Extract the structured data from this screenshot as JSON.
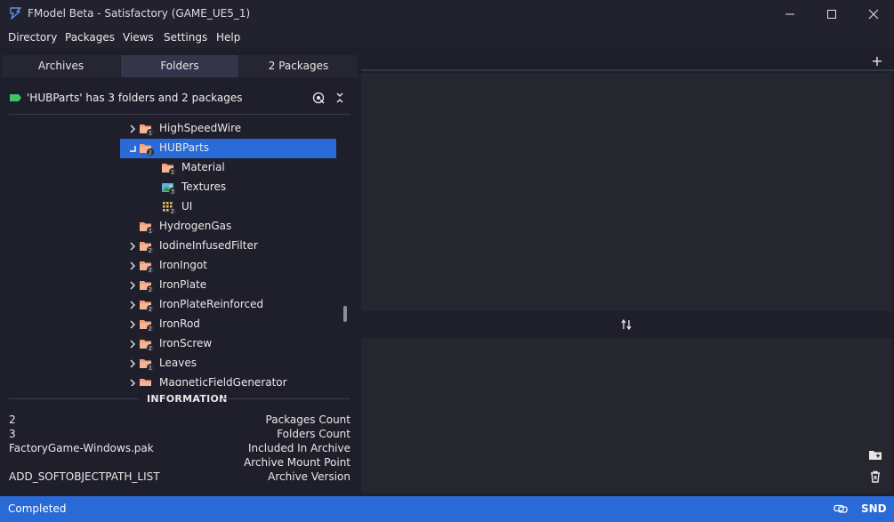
{
  "window": {
    "title": "FModel Beta - Satisfactory (GAME_UE5_1)"
  },
  "menu": [
    "Directory",
    "Packages",
    "Views",
    "Settings",
    "Help"
  ],
  "tabs": [
    {
      "label": "Archives",
      "active": false
    },
    {
      "label": "Folders",
      "active": true
    },
    {
      "label": "2 Packages",
      "active": false
    }
  ],
  "folder_header": {
    "text": "'HUBParts' has 3 folders and 2 packages"
  },
  "tree": [
    {
      "label": "HighSpeedWire",
      "count": "1",
      "icon": "folder-icon",
      "expander": "collapsed",
      "selected": false
    },
    {
      "label": "HUBParts",
      "count": "2",
      "icon": "folder-icon",
      "expander": "expanded",
      "selected": true
    },
    {
      "label": "Material",
      "count": "1",
      "icon": "folder-icon",
      "expander": "none",
      "selected": false
    },
    {
      "label": "Textures",
      "count": "3",
      "icon": "texture-folder-icon",
      "expander": "none",
      "selected": false
    },
    {
      "label": "UI",
      "count": "2",
      "icon": "ui-folder-icon",
      "expander": "none",
      "selected": false
    },
    {
      "label": "HydrogenGas",
      "count": "1",
      "icon": "folder-icon",
      "expander": "none",
      "selected": false
    },
    {
      "label": "IodineInfusedFilter",
      "count": "2",
      "icon": "folder-icon",
      "expander": "collapsed",
      "selected": false
    },
    {
      "label": "IronIngot",
      "count": "2",
      "icon": "folder-icon",
      "expander": "collapsed",
      "selected": false
    },
    {
      "label": "IronPlate",
      "count": "2",
      "icon": "folder-icon",
      "expander": "collapsed",
      "selected": false
    },
    {
      "label": "IronPlateReinforced",
      "count": "2",
      "icon": "folder-icon",
      "expander": "collapsed",
      "selected": false
    },
    {
      "label": "IronRod",
      "count": "2",
      "icon": "folder-icon",
      "expander": "collapsed",
      "selected": false
    },
    {
      "label": "IronScrew",
      "count": "2",
      "icon": "folder-icon",
      "expander": "collapsed",
      "selected": false
    },
    {
      "label": "Leaves",
      "count": "1",
      "icon": "folder-icon",
      "expander": "collapsed",
      "selected": false
    },
    {
      "label": "MagneticFieldGenerator",
      "count": "",
      "icon": "folder-icon",
      "expander": "collapsed",
      "selected": false
    }
  ],
  "information": {
    "title": "INFORMATION",
    "rows": [
      {
        "value": "2",
        "key": "Packages Count"
      },
      {
        "value": "3",
        "key": "Folders Count"
      },
      {
        "value": "FactoryGame-Windows.pak",
        "key": "Included In Archive"
      },
      {
        "value": "",
        "key": "Archive Mount Point"
      },
      {
        "value": "ADD_SOFTOBJECTPATH_LIST",
        "key": "Archive Version"
      }
    ]
  },
  "editor": {
    "add_tab_label": "+"
  },
  "status": {
    "text": "Completed",
    "right_label": "SND"
  },
  "colors": {
    "accent": "#2a6ad6",
    "folder": "#f2a07a",
    "background": "#1f1f2b",
    "panel": "#26262f"
  }
}
